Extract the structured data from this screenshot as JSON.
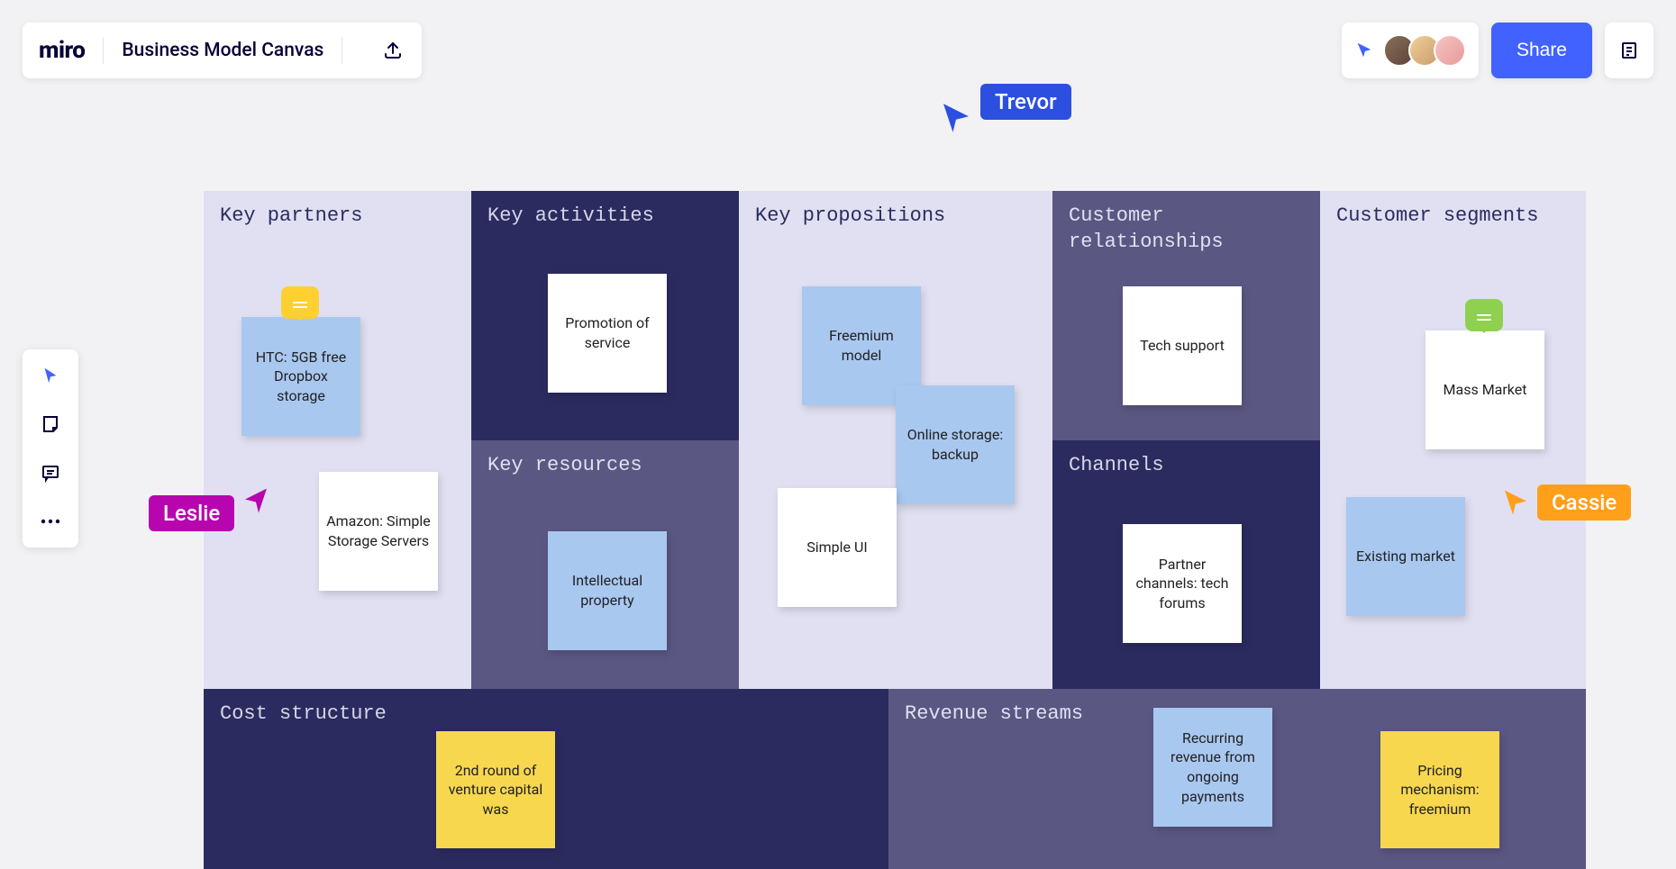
{
  "app": {
    "logo": "miro",
    "board_title": "Business Model Canvas",
    "share_label": "Share"
  },
  "sections": {
    "key_partners": {
      "title": "Key partners"
    },
    "key_activities": {
      "title": "Key activities"
    },
    "key_resources": {
      "title": "Key resources"
    },
    "key_propositions": {
      "title": "Key propositions"
    },
    "customer_relationships": {
      "title": "Customer\nrelationships"
    },
    "channels": {
      "title": "Channels"
    },
    "customer_segments": {
      "title": "Customer segments"
    },
    "cost_structure": {
      "title": "Cost structure"
    },
    "revenue_streams": {
      "title": "Revenue streams"
    }
  },
  "stickies": {
    "htc": "HTC: 5GB free Dropbox storage",
    "amazon": "Amazon: Simple Storage Servers",
    "promotion": "Promotion of service",
    "intellectual": "Intellectual property",
    "freemium": "Freemium model",
    "online_storage": "Online storage: backup",
    "simple_ui": "Simple UI",
    "tech_support": "Tech support",
    "partner_channels": "Partner channels: tech forums",
    "mass_market": "Mass Market",
    "existing_market": "Existing market",
    "venture": "2nd round of venture capital was",
    "recurring": "Recurring revenue from ongoing payments",
    "pricing": "Pricing mechanism: freemium"
  },
  "cursors": {
    "trevor": "Trevor",
    "leslie": "Leslie",
    "cassie": "Cassie"
  }
}
